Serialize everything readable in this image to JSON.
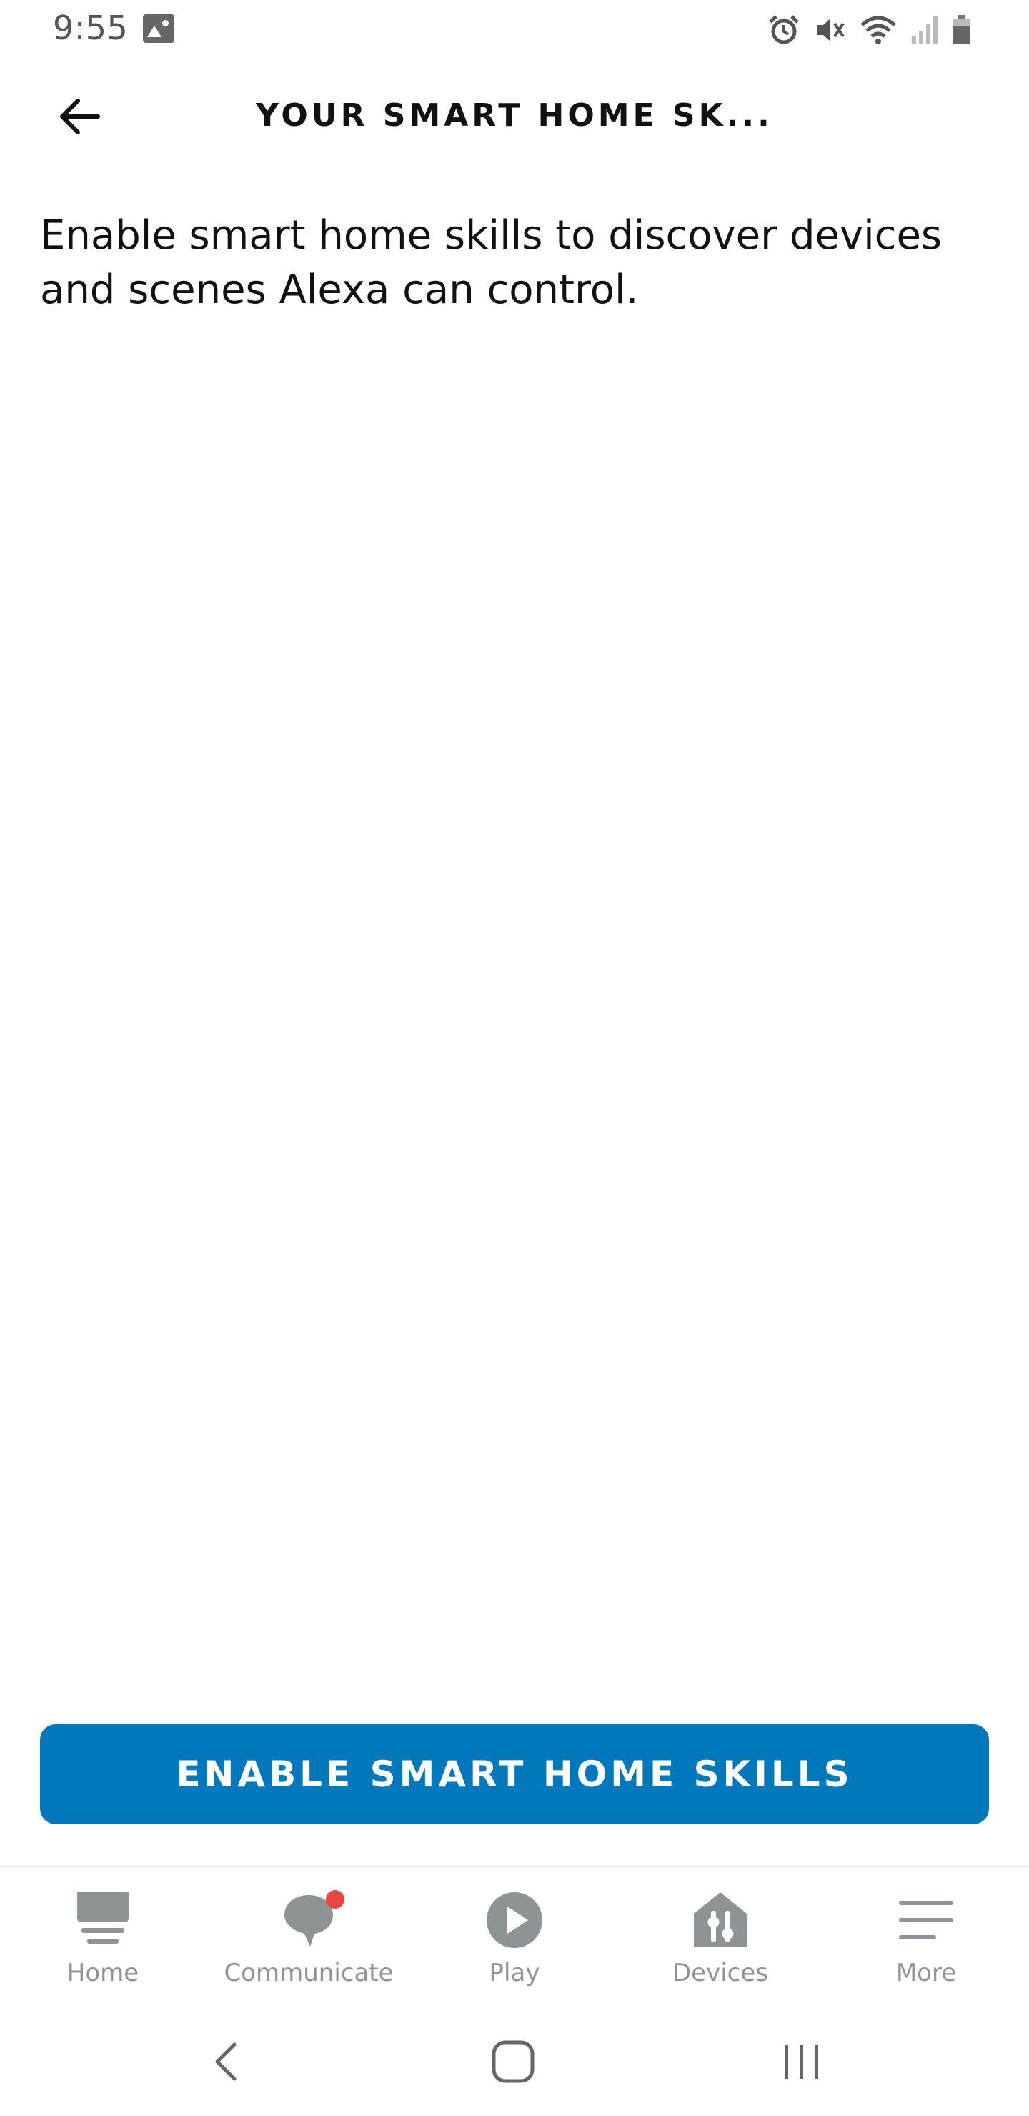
{
  "status_bar": {
    "time": "9:55",
    "icons": [
      "gallery-icon",
      "alarm-icon",
      "mute-icon",
      "wifi-icon",
      "signal-icon",
      "battery-icon"
    ]
  },
  "header": {
    "title": "YOUR SMART HOME SK...",
    "back_icon": "arrow-left-icon"
  },
  "main": {
    "description": "Enable smart home skills to discover devices and scenes Alexa can control."
  },
  "primary_button": {
    "label": "ENABLE SMART HOME SKILLS",
    "color": "#0078BC"
  },
  "bottom_nav": {
    "items": [
      {
        "label": "Home",
        "icon": "home-icon"
      },
      {
        "label": "Communicate",
        "icon": "chat-bubble-icon",
        "badge": true
      },
      {
        "label": "Play",
        "icon": "play-icon"
      },
      {
        "label": "Devices",
        "icon": "devices-icon"
      },
      {
        "label": "More",
        "icon": "menu-icon"
      }
    ],
    "icon_color": "#8e9396",
    "badge_color": "#e8463f"
  },
  "system_nav": {
    "buttons": [
      "back-icon",
      "home-button-icon",
      "recents-icon"
    ]
  }
}
